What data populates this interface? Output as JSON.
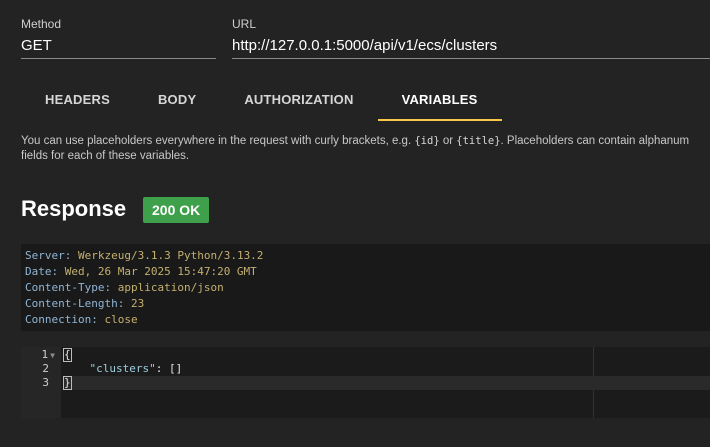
{
  "request": {
    "method_label": "Method",
    "method_value": "GET",
    "url_label": "URL",
    "url_value": "http://127.0.0.1:5000/api/v1/ecs/clusters"
  },
  "tabs": [
    {
      "label": "HEADERS",
      "active": false
    },
    {
      "label": "BODY",
      "active": false
    },
    {
      "label": "AUTHORIZATION",
      "active": false
    },
    {
      "label": "VARIABLES",
      "active": true
    }
  ],
  "variables_help": {
    "part1": "You can use placeholders everywhere in the request with curly brackets, e.g. ",
    "code1": "{id}",
    "part2": " or ",
    "code2": "{title}",
    "part3": ". Placeholders can contain alphanum",
    "line2": "fields for each of these variables."
  },
  "response": {
    "title": "Response",
    "status": "200 OK",
    "status_color": "#3ea04a",
    "headers": [
      {
        "key": "Server",
        "value": "Werkzeug/3.1.3 Python/3.13.2"
      },
      {
        "key": "Date",
        "value": "Wed, 26 Mar 2025 15:47:20 GMT"
      },
      {
        "key": "Content-Type",
        "value": "application/json"
      },
      {
        "key": "Content-Length",
        "value": "23"
      },
      {
        "key": "Connection",
        "value": "close"
      }
    ],
    "body_lines": [
      {
        "number": "1",
        "text": "{"
      },
      {
        "number": "2",
        "key": "\"clusters\"",
        "rest": ": []"
      },
      {
        "number": "3",
        "text": "}"
      }
    ]
  }
}
